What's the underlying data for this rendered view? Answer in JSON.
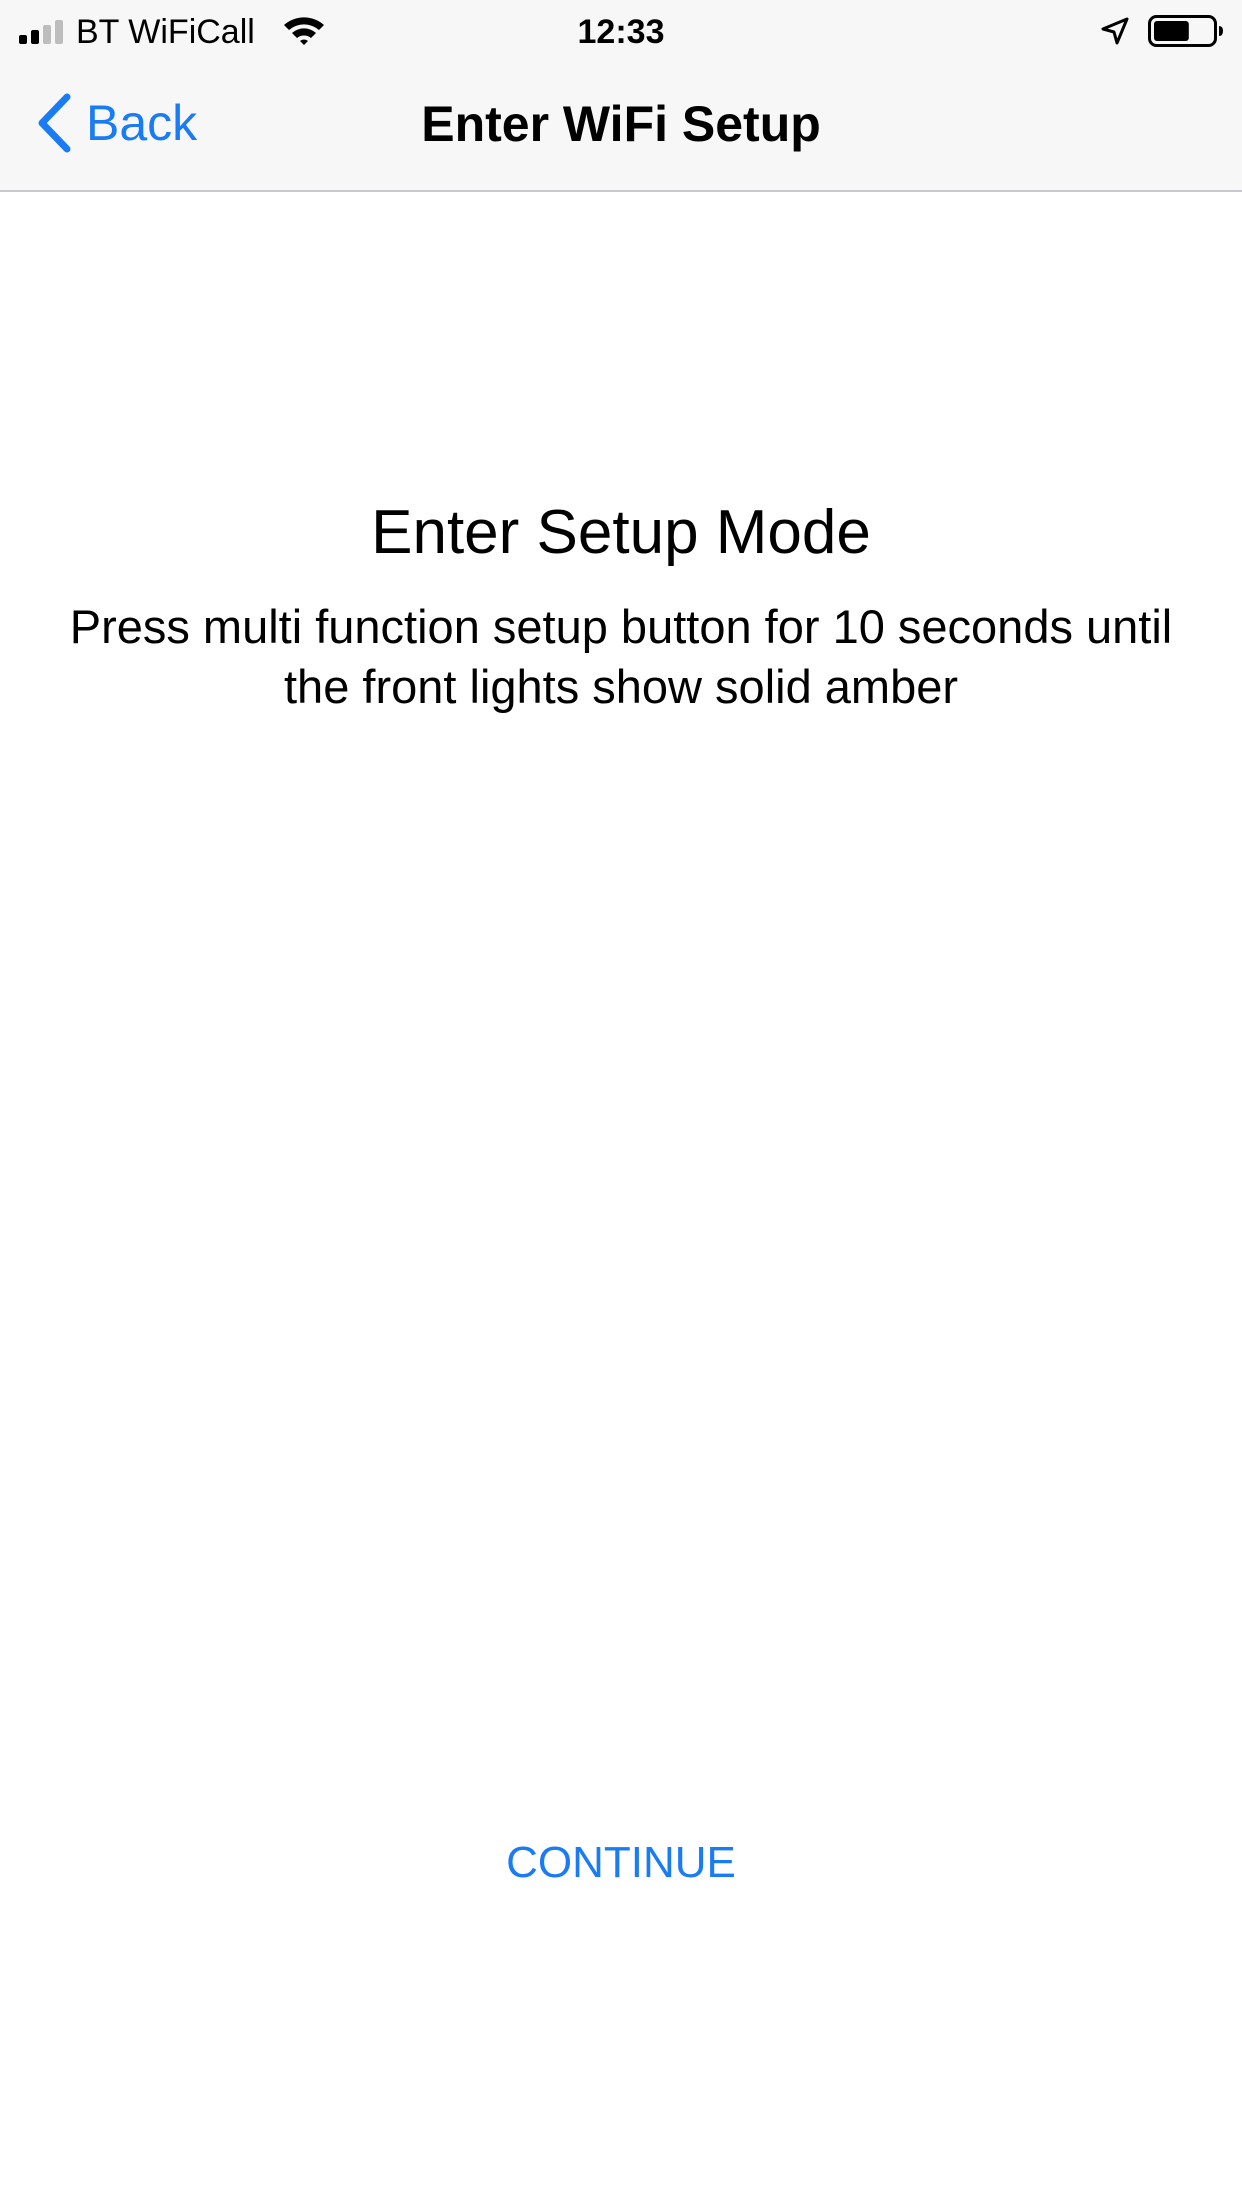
{
  "status_bar": {
    "carrier": "BT WiFiCall",
    "time": "12:33",
    "signal_bars_filled": 2,
    "signal_bars_total": 4,
    "battery_level": 0.6,
    "icons": [
      "signal-icon",
      "wifi-icon",
      "location-arrow-icon",
      "battery-icon"
    ]
  },
  "nav_bar": {
    "back_label": "Back",
    "title": "Enter WiFi Setup"
  },
  "content": {
    "heading": "Enter Setup Mode",
    "instructions": "Press multi function setup button for 10 seconds until the front lights show solid amber"
  },
  "actions": {
    "continue_label": "CONTINUE"
  },
  "colors": {
    "accent": "#1a7cf4",
    "bar_background": "#f7f7f7",
    "separator": "#c8c7cc",
    "text": "#000000"
  }
}
